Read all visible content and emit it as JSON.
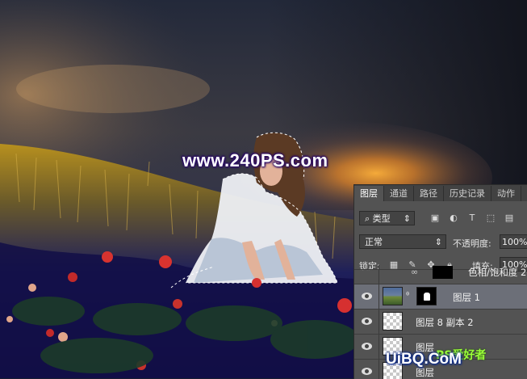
{
  "watermark": {
    "main": "www.240PS.com",
    "bottom_site": "UiBQ.CoM",
    "bottom_brand": "PS爱好者"
  },
  "layers_panel": {
    "tabs": [
      "图层",
      "通道",
      "路径",
      "历史记录",
      "动作"
    ],
    "active_tab": "图层",
    "filter": {
      "label": "类型"
    },
    "blend_mode": "正常",
    "opacity_label": "不透明度:",
    "opacity_value": "100%",
    "lock_label": "锁定:",
    "fill_label": "填充:",
    "fill_value": "100%",
    "layers": [
      {
        "name": "色相/饱和度 2",
        "visible": false,
        "type": "adjustment"
      },
      {
        "name": "图层 1",
        "visible": true,
        "type": "masked-photo",
        "selected": true
      },
      {
        "name": "图层 8 副本 2",
        "visible": true,
        "type": "transparent"
      },
      {
        "name": "图层",
        "visible": true,
        "type": "transparent"
      },
      {
        "name": "图层",
        "visible": true,
        "type": "transparent"
      }
    ]
  },
  "colors": {
    "panel_bg": "#535353",
    "selected_layer": "#6c6f78",
    "watermark_shadow": "#2a0a66"
  }
}
